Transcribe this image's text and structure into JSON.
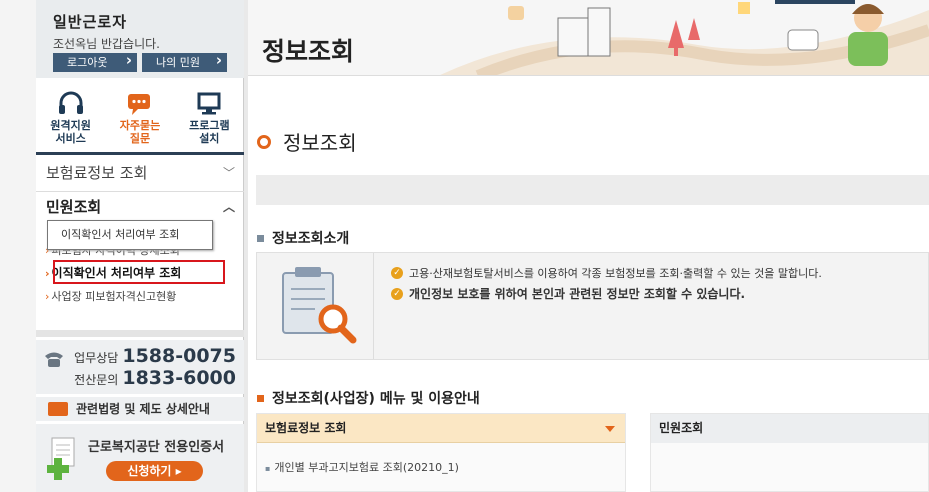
{
  "user": {
    "name": "일반근로자",
    "greeting": "조선옥님 반갑습니다.",
    "logout": "로그아웃",
    "my_civil": "나의 민원"
  },
  "quick": [
    {
      "label1": "원격지원",
      "label2": "서비스",
      "icon": "headset-icon"
    },
    {
      "label1": "자주묻는",
      "label2": "질문",
      "icon": "chat-bubble-icon"
    },
    {
      "label1": "프로그램",
      "label2": "설치",
      "icon": "monitor-icon"
    }
  ],
  "menu": {
    "insurance_info": "보험료정보 조회",
    "civil": "민원조회",
    "sub1": "피보험자 자격이력 상세조회",
    "sub2": "이직확인서 처리여부 조회",
    "sub3": "사업장 피보험자격신고현황",
    "tooltip": "이직확인서 처리여부 조회"
  },
  "contact": {
    "label1": "업무상담",
    "num1": "1588-0075",
    "label2": "전산문의",
    "num2": "1833-6000"
  },
  "law": "관련법령 및 제도 상세안내",
  "cert": {
    "title": "근로복지공단 전용인증서",
    "btn": "신청하기"
  },
  "header": {
    "title": "정보조회"
  },
  "main": {
    "h2": "정보조회",
    "sec1": "정보조회소개",
    "bullet1": "고용·산재보험토탈서비스를 이용하여 각종 보험정보를 조회·출력할 수 있는 것을 말합니다.",
    "bullet2": "개인정보 보호를 위하여 본인과 관련된 정보만 조회할 수 있습니다.",
    "sec2": "정보조회(사업장) 메뉴 및 이용안내",
    "panel1_title": "보험료정보 조회",
    "panel1_item": "개인별 부과고지보험료 조회(20210_1)",
    "panel2_title": "민원조회"
  },
  "colors": {
    "accent": "#e2651b",
    "navy": "#2b3f55",
    "highlight": "#d8161c"
  }
}
